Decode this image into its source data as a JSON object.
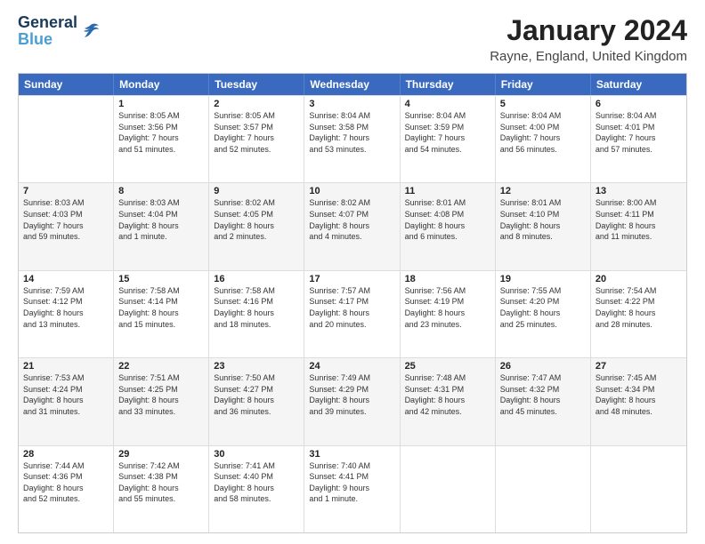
{
  "header": {
    "logo_line1": "General",
    "logo_line2": "Blue",
    "month": "January 2024",
    "location": "Rayne, England, United Kingdom"
  },
  "days": [
    "Sunday",
    "Monday",
    "Tuesday",
    "Wednesday",
    "Thursday",
    "Friday",
    "Saturday"
  ],
  "weeks": [
    [
      {
        "day": "",
        "content": ""
      },
      {
        "day": "1",
        "content": "Sunrise: 8:05 AM\nSunset: 3:56 PM\nDaylight: 7 hours\nand 51 minutes."
      },
      {
        "day": "2",
        "content": "Sunrise: 8:05 AM\nSunset: 3:57 PM\nDaylight: 7 hours\nand 52 minutes."
      },
      {
        "day": "3",
        "content": "Sunrise: 8:04 AM\nSunset: 3:58 PM\nDaylight: 7 hours\nand 53 minutes."
      },
      {
        "day": "4",
        "content": "Sunrise: 8:04 AM\nSunset: 3:59 PM\nDaylight: 7 hours\nand 54 minutes."
      },
      {
        "day": "5",
        "content": "Sunrise: 8:04 AM\nSunset: 4:00 PM\nDaylight: 7 hours\nand 56 minutes."
      },
      {
        "day": "6",
        "content": "Sunrise: 8:04 AM\nSunset: 4:01 PM\nDaylight: 7 hours\nand 57 minutes."
      }
    ],
    [
      {
        "day": "7",
        "content": "Sunrise: 8:03 AM\nSunset: 4:03 PM\nDaylight: 7 hours\nand 59 minutes."
      },
      {
        "day": "8",
        "content": "Sunrise: 8:03 AM\nSunset: 4:04 PM\nDaylight: 8 hours\nand 1 minute."
      },
      {
        "day": "9",
        "content": "Sunrise: 8:02 AM\nSunset: 4:05 PM\nDaylight: 8 hours\nand 2 minutes."
      },
      {
        "day": "10",
        "content": "Sunrise: 8:02 AM\nSunset: 4:07 PM\nDaylight: 8 hours\nand 4 minutes."
      },
      {
        "day": "11",
        "content": "Sunrise: 8:01 AM\nSunset: 4:08 PM\nDaylight: 8 hours\nand 6 minutes."
      },
      {
        "day": "12",
        "content": "Sunrise: 8:01 AM\nSunset: 4:10 PM\nDaylight: 8 hours\nand 8 minutes."
      },
      {
        "day": "13",
        "content": "Sunrise: 8:00 AM\nSunset: 4:11 PM\nDaylight: 8 hours\nand 11 minutes."
      }
    ],
    [
      {
        "day": "14",
        "content": "Sunrise: 7:59 AM\nSunset: 4:12 PM\nDaylight: 8 hours\nand 13 minutes."
      },
      {
        "day": "15",
        "content": "Sunrise: 7:58 AM\nSunset: 4:14 PM\nDaylight: 8 hours\nand 15 minutes."
      },
      {
        "day": "16",
        "content": "Sunrise: 7:58 AM\nSunset: 4:16 PM\nDaylight: 8 hours\nand 18 minutes."
      },
      {
        "day": "17",
        "content": "Sunrise: 7:57 AM\nSunset: 4:17 PM\nDaylight: 8 hours\nand 20 minutes."
      },
      {
        "day": "18",
        "content": "Sunrise: 7:56 AM\nSunset: 4:19 PM\nDaylight: 8 hours\nand 23 minutes."
      },
      {
        "day": "19",
        "content": "Sunrise: 7:55 AM\nSunset: 4:20 PM\nDaylight: 8 hours\nand 25 minutes."
      },
      {
        "day": "20",
        "content": "Sunrise: 7:54 AM\nSunset: 4:22 PM\nDaylight: 8 hours\nand 28 minutes."
      }
    ],
    [
      {
        "day": "21",
        "content": "Sunrise: 7:53 AM\nSunset: 4:24 PM\nDaylight: 8 hours\nand 31 minutes."
      },
      {
        "day": "22",
        "content": "Sunrise: 7:51 AM\nSunset: 4:25 PM\nDaylight: 8 hours\nand 33 minutes."
      },
      {
        "day": "23",
        "content": "Sunrise: 7:50 AM\nSunset: 4:27 PM\nDaylight: 8 hours\nand 36 minutes."
      },
      {
        "day": "24",
        "content": "Sunrise: 7:49 AM\nSunset: 4:29 PM\nDaylight: 8 hours\nand 39 minutes."
      },
      {
        "day": "25",
        "content": "Sunrise: 7:48 AM\nSunset: 4:31 PM\nDaylight: 8 hours\nand 42 minutes."
      },
      {
        "day": "26",
        "content": "Sunrise: 7:47 AM\nSunset: 4:32 PM\nDaylight: 8 hours\nand 45 minutes."
      },
      {
        "day": "27",
        "content": "Sunrise: 7:45 AM\nSunset: 4:34 PM\nDaylight: 8 hours\nand 48 minutes."
      }
    ],
    [
      {
        "day": "28",
        "content": "Sunrise: 7:44 AM\nSunset: 4:36 PM\nDaylight: 8 hours\nand 52 minutes."
      },
      {
        "day": "29",
        "content": "Sunrise: 7:42 AM\nSunset: 4:38 PM\nDaylight: 8 hours\nand 55 minutes."
      },
      {
        "day": "30",
        "content": "Sunrise: 7:41 AM\nSunset: 4:40 PM\nDaylight: 8 hours\nand 58 minutes."
      },
      {
        "day": "31",
        "content": "Sunrise: 7:40 AM\nSunset: 4:41 PM\nDaylight: 9 hours\nand 1 minute."
      },
      {
        "day": "",
        "content": ""
      },
      {
        "day": "",
        "content": ""
      },
      {
        "day": "",
        "content": ""
      }
    ]
  ]
}
